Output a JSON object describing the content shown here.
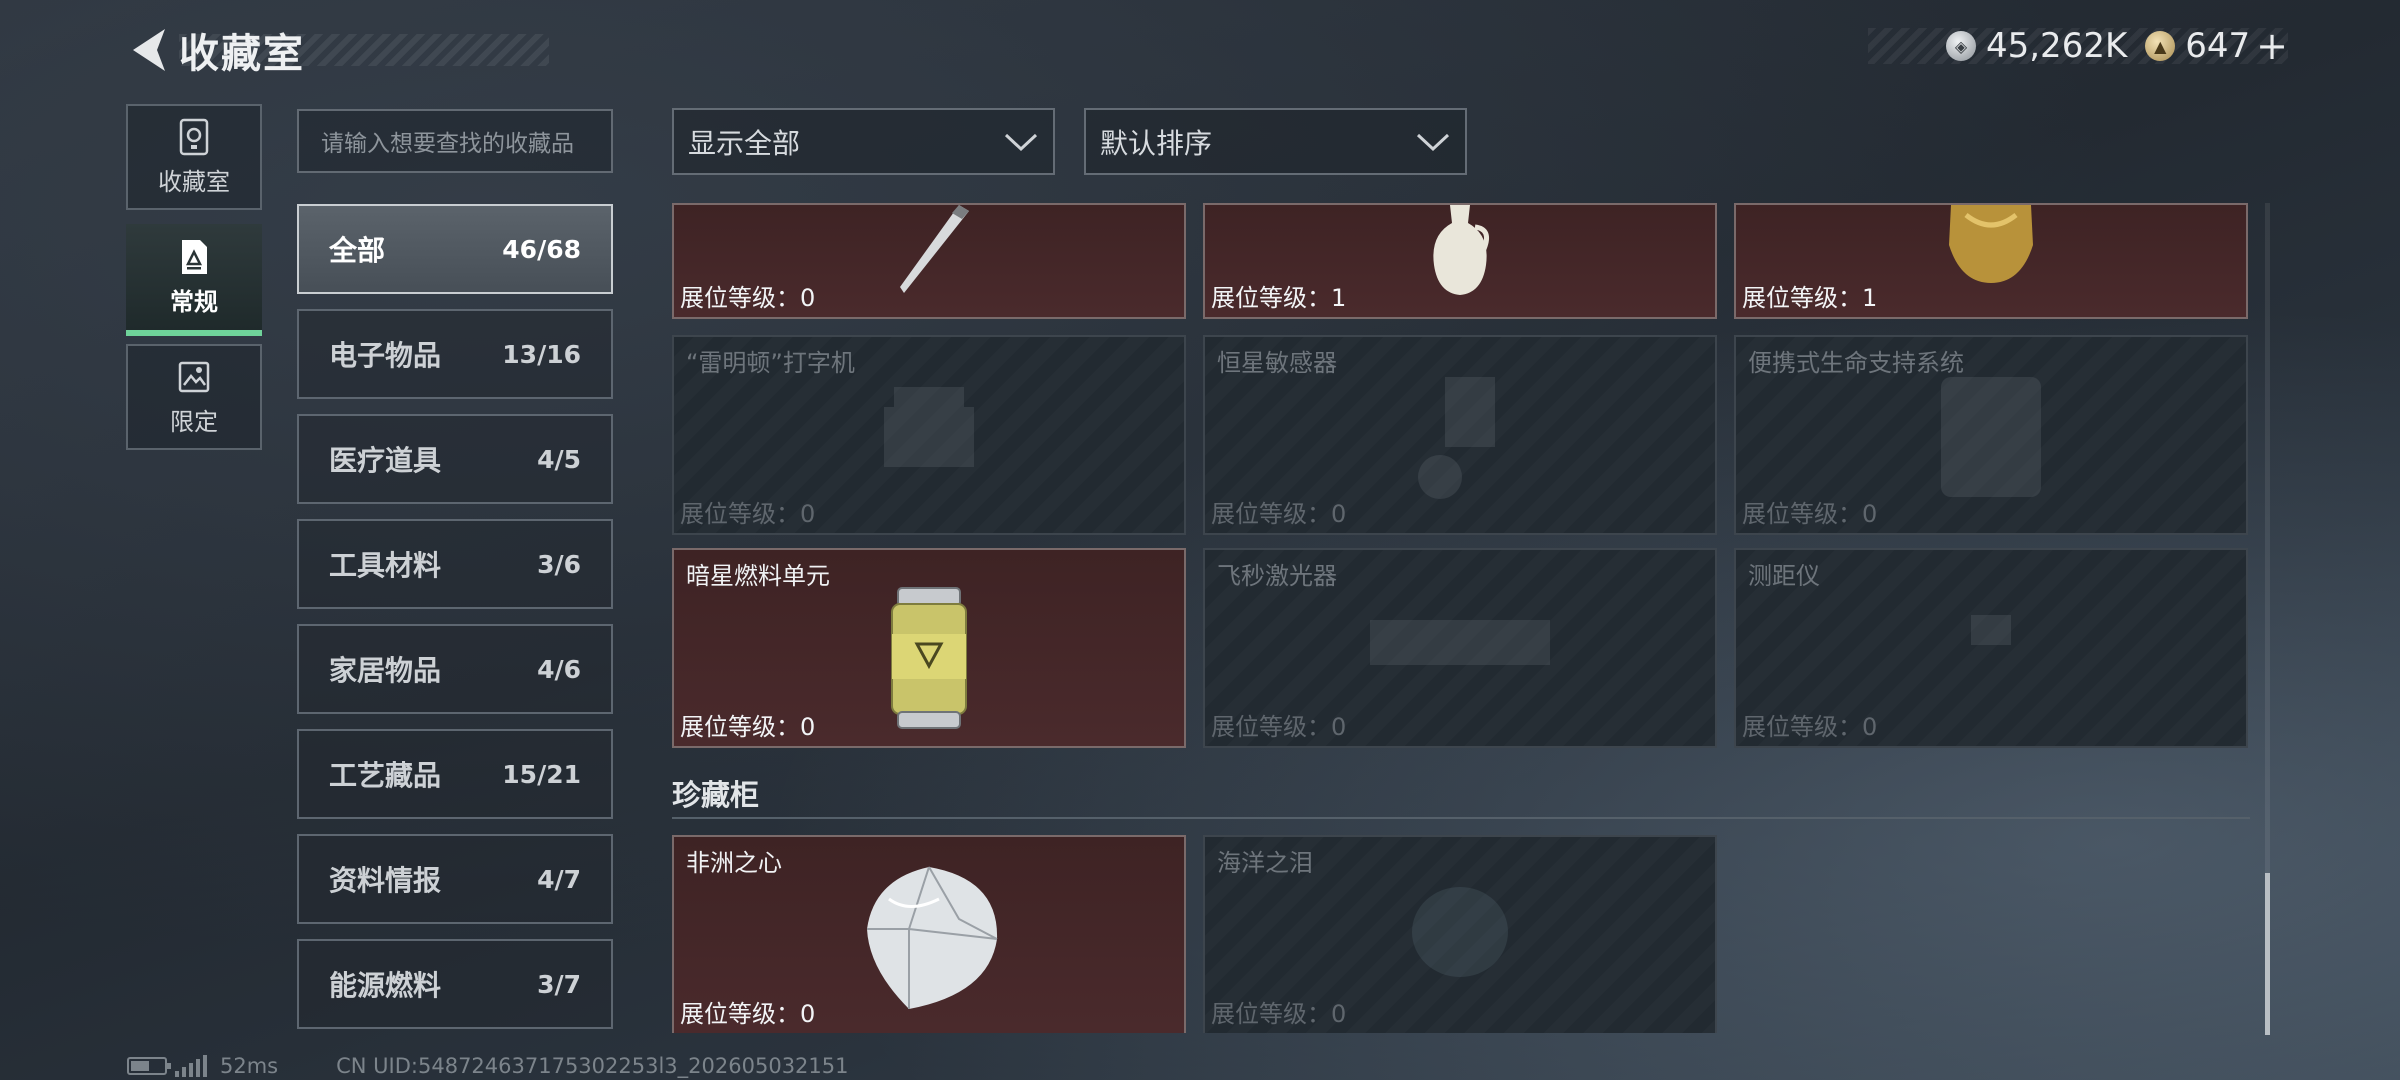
{
  "header": {
    "title": "收藏室"
  },
  "currency": {
    "silver": "45,262K",
    "gold": "647",
    "plus": "+"
  },
  "rail": [
    {
      "label": "收藏室",
      "icon": "vault-icon",
      "active": false
    },
    {
      "label": "常规",
      "icon": "document-icon",
      "active": true
    },
    {
      "label": "限定",
      "icon": "image-icon",
      "active": false
    }
  ],
  "search": {
    "placeholder": "请输入想要查找的收藏品"
  },
  "categories": [
    {
      "label": "全部",
      "count": "46/68",
      "active": true
    },
    {
      "label": "电子物品",
      "count": "13/16"
    },
    {
      "label": "医疗道具",
      "count": "4/5"
    },
    {
      "label": "工具材料",
      "count": "3/6"
    },
    {
      "label": "家居物品",
      "count": "4/6"
    },
    {
      "label": "工艺藏品",
      "count": "15/21"
    },
    {
      "label": "资料情报",
      "count": "4/7"
    },
    {
      "label": "能源燃料",
      "count": "3/7"
    }
  ],
  "filters": {
    "show": "显示全部",
    "sort": "默认排序"
  },
  "cards": [
    {
      "name": "",
      "level": "展位等级：0",
      "owned": true
    },
    {
      "name": "",
      "level": "展位等级：1",
      "owned": true
    },
    {
      "name": "",
      "level": "展位等级：1",
      "owned": true
    },
    {
      "name": "“雷明顿”打字机",
      "level": "展位等级：0",
      "owned": false
    },
    {
      "name": "恒星敏感器",
      "level": "展位等级：0",
      "owned": false
    },
    {
      "name": "便携式生命支持系统",
      "level": "展位等级：0",
      "owned": false
    },
    {
      "name": "暗星燃料单元",
      "level": "展位等级：0",
      "owned": true
    },
    {
      "name": "飞秒激光器",
      "level": "展位等级：0",
      "owned": false
    },
    {
      "name": "测距仪",
      "level": "展位等级：0",
      "owned": false
    }
  ],
  "section": {
    "title": "珍藏柜"
  },
  "treasures": [
    {
      "name": "非洲之心",
      "level": "展位等级：0",
      "owned": true
    },
    {
      "name": "海洋之泪",
      "level": "展位等级：0",
      "owned": false
    }
  ],
  "footer": {
    "ping": "52ms",
    "uid": "CN UID:548724637175302253l3_202605032151"
  }
}
